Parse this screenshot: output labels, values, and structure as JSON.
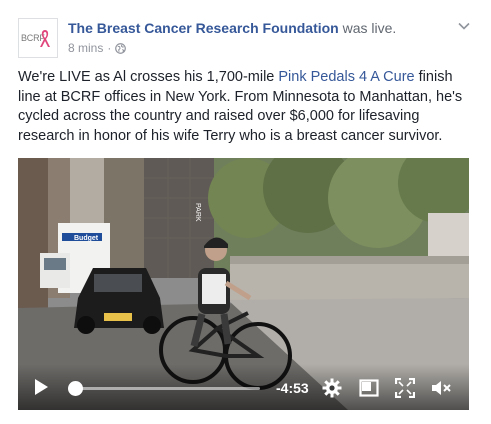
{
  "post": {
    "page_name": "The Breast Cancer Research Foundation",
    "status": "was live.",
    "time_ago": "8 mins",
    "separator": "·",
    "avatar_text": "BCRF",
    "body": {
      "part1": "We're LIVE as Al crosses his 1,700-mile ",
      "link": "Pink Pedals 4 A Cure",
      "part2": " finish line at BCRF offices in New York. From Minnesota to Manhattan, he's cycled across the country and raised over $6,000 for lifesaving research in honor of his wife Terry who is a breast cancer survivor."
    }
  },
  "video": {
    "truck_sign": "Budget",
    "tree_label": "PARK",
    "progress": 0.02,
    "time_remaining": "-4:53",
    "icons": {
      "play": "play-icon",
      "settings": "gear-icon",
      "pip": "picture-in-picture-icon",
      "fullscreen": "fullscreen-icon",
      "mute": "mute-icon"
    }
  },
  "colors": {
    "link": "#365899",
    "meta": "#90949c",
    "text": "#1d2129",
    "ribbon": "#e0457b"
  }
}
